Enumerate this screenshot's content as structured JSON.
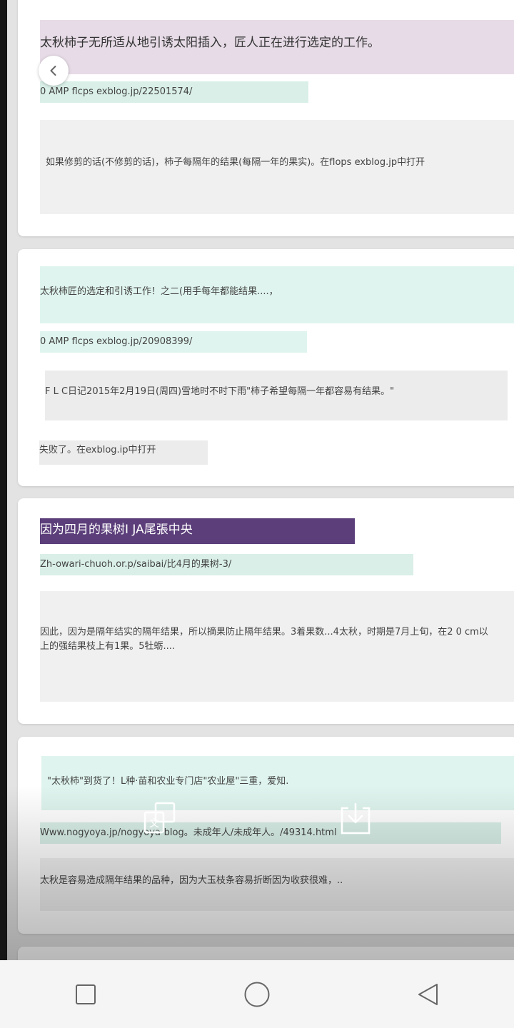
{
  "cards": [
    {
      "title": "太秋柿子无所适从地引诱太阳插入，匠人正在进行选定的工作。",
      "url": "0 AMP flcps exblog.jp/22501574/",
      "snippet": "如果修剪的话(不修剪的话)，柿子每隔年的结果(每隔一年的果实)。在flops exblog.jp中打开"
    },
    {
      "title": "太秋柿匠的选定和引诱工作！之二(用手每年都能结果....，",
      "url": "0 AMP flcps exblog.jp/20908399/",
      "snippet": "F L C日记2015年2月19日(周四)雪地时不时下雨\"柿子希望每隔一年都容易有结果。\"",
      "extra": "失败了。在exblog.ip中打开"
    },
    {
      "title": "因为四月的果树I JA尾張中央",
      "url": "Zh-owari-chuoh.or.p/saibai/比4月的果树-3/",
      "snippet_line1": "因此，因为是隔年结实的隔年结果，所以摘果防止隔年结果。3着果数...4太秋，时期是7月上旬，在2 0 cm以",
      "snippet_line2": "上的强结果枝上有1果。5牡蛎...."
    },
    {
      "title": "\"太秋柿\"到货了！L种·苗和农业专门店\"农业屋\"三重，爱知.",
      "url": "Www.nogyoya.jp/nogyoya-blog。未成年人/未成年人。/49314.html",
      "snippet": "太秋是容易造成隔年结果的品种，因为大玉枝条容易折断因为收获很难，.."
    }
  ],
  "icons": {
    "back": "chevron-left-icon",
    "translate": "translate-icon",
    "download": "download-icon",
    "nav_recent": "square-icon",
    "nav_home": "circle-icon",
    "nav_back": "triangle-back-icon"
  },
  "colors": {
    "highlight_purple": "#5b3e7a",
    "highlight_mint": "#d9efe8"
  }
}
